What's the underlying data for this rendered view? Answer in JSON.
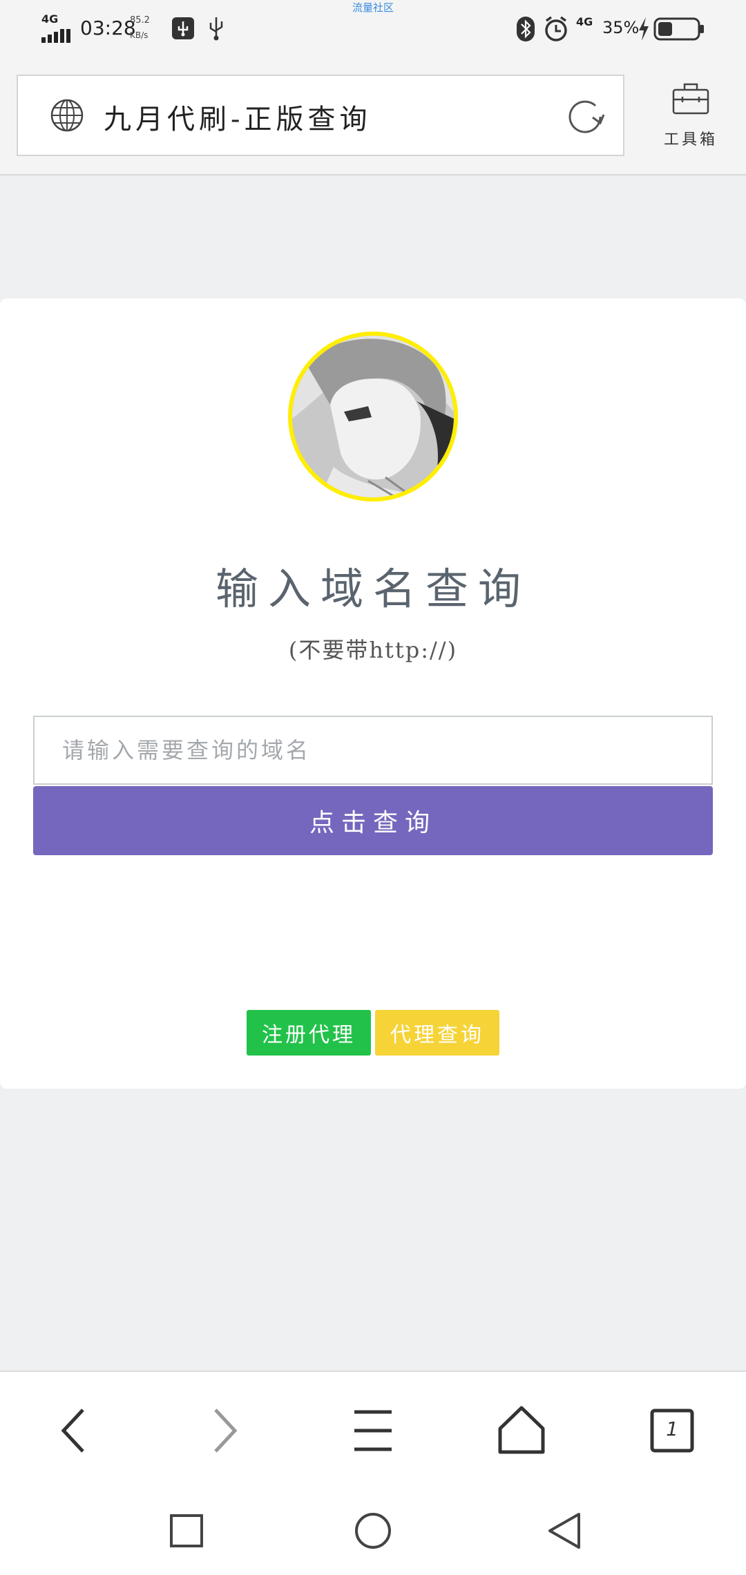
{
  "status_bar": {
    "network": "4G",
    "time": "03:28",
    "speed_value": "85.2",
    "speed_unit": "KB/s",
    "center_text": "流量社区",
    "network_right": "4G",
    "battery": "35%"
  },
  "address_bar": {
    "title": "九月代刷-正版查询",
    "toolbox_label": "工具箱"
  },
  "main": {
    "heading": "输入域名查询",
    "subheading": "(不要带http://)",
    "input_placeholder": "请输入需要查询的域名",
    "input_value": "",
    "query_button": "点击查询",
    "register_agent_button": "注册代理",
    "agent_query_button": "代理查询"
  },
  "colors": {
    "query_button": "#7467bd",
    "register_button": "#22c24a",
    "agent_query_button": "#f6d337",
    "avatar_border": "#ffee00"
  },
  "icons": {
    "address": [
      "globe-icon",
      "refresh-icon",
      "toolbox-icon"
    ],
    "browser_nav": [
      "back-arrow-icon",
      "forward-arrow-icon",
      "menu-icon",
      "home-icon",
      "tabs-icon"
    ],
    "system_nav": [
      "square-recents-icon",
      "circle-home-icon",
      "triangle-back-icon"
    ]
  },
  "browser_nav": {
    "tab_count": "1"
  }
}
